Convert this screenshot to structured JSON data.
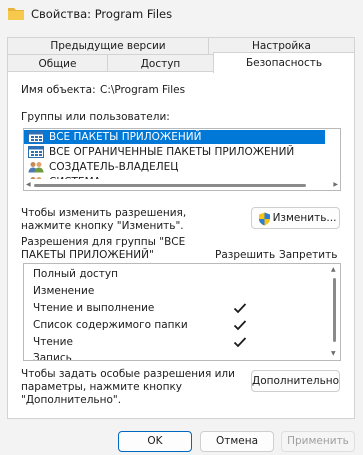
{
  "window": {
    "title": "Свойства: Program Files",
    "icon": "folder-icon"
  },
  "tabs": {
    "row1": [
      {
        "label": "Предыдущие версии"
      },
      {
        "label": "Настройка"
      }
    ],
    "row2": [
      {
        "label": "Общие"
      },
      {
        "label": "Доступ"
      },
      {
        "label": "Безопасность",
        "active": true
      }
    ]
  },
  "security": {
    "object_name_label": "Имя объекта:",
    "object_name_value": "C:\\Program Files",
    "groups_label": "Группы или пользователи:",
    "groups": [
      {
        "label": "ВСЕ ПАКЕТЫ ПРИЛОЖЕНИЙ",
        "icon": "app-package-icon",
        "selected": true
      },
      {
        "label": "ВСЕ ОГРАНИЧЕННЫЕ ПАКЕТЫ ПРИЛОЖЕНИЙ",
        "icon": "app-package-icon"
      },
      {
        "label": "СОЗДАТЕЛЬ-ВЛАДЕЛЕЦ",
        "icon": "users-icon"
      },
      {
        "label": "СИСТЕМА",
        "icon": "users-icon"
      }
    ],
    "edit_hint_line1": "Чтобы изменить разрешения,",
    "edit_hint_line2": "нажмите кнопку \"Изменить\".",
    "edit_button": "Изменить...",
    "perm_header_line1": "Разрешения для группы \"ВСЕ",
    "perm_header_line2": "ПАКЕТЫ ПРИЛОЖЕНИЙ\"",
    "allow_label": "Разрешить",
    "deny_label": "Запретить",
    "permissions": [
      {
        "label": "Полный доступ",
        "allow": false
      },
      {
        "label": "Изменение",
        "allow": false
      },
      {
        "label": "Чтение и выполнение",
        "allow": true
      },
      {
        "label": "Список содержимого папки",
        "allow": true
      },
      {
        "label": "Чтение",
        "allow": true
      },
      {
        "label": "Запись",
        "allow": false
      }
    ],
    "advanced_hint_line1": "Чтобы задать особые разрешения или",
    "advanced_hint_line2": "параметры, нажмите кнопку",
    "advanced_hint_line3": "\"Дополнительно\".",
    "advanced_button": "Дополнительно"
  },
  "footer": {
    "ok": "OK",
    "cancel": "Отмена",
    "apply": "Применить"
  },
  "colors": {
    "selection": "#0078d7",
    "primary_border": "#0067c0"
  }
}
